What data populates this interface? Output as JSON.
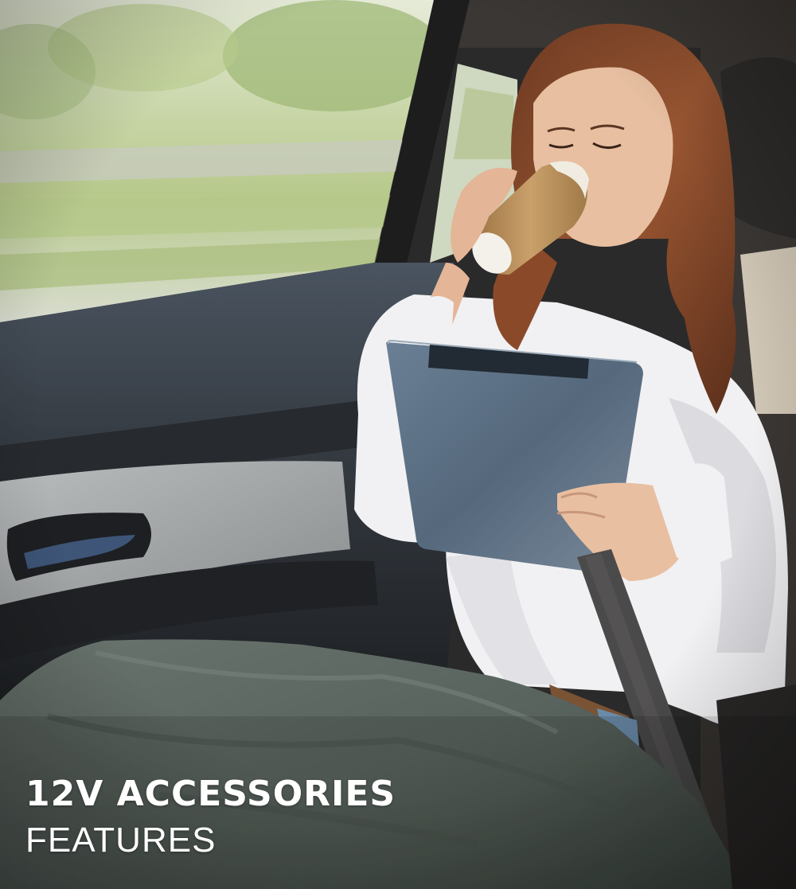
{
  "hero": {
    "title": "12V ACCESSORIES",
    "subtitle": "FEATURES"
  },
  "colors": {
    "text": "#ffffff",
    "blanket": "#5b6660",
    "tablet": "#54687e",
    "shirt": "#f1f1f3",
    "hair": "#8a4a2a",
    "cup": "#b58a55"
  }
}
